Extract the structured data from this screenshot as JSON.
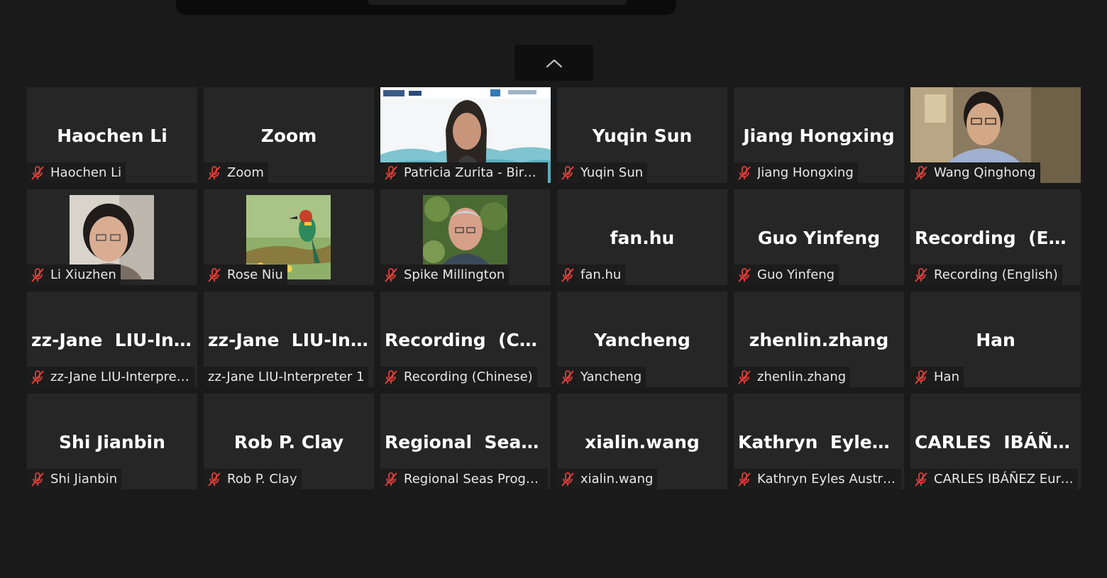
{
  "tiles": [
    {
      "display_name": "Haochen Li",
      "label": "Haochen Li",
      "muted": true
    },
    {
      "display_name": "Zoom",
      "label": "Zoom",
      "muted": true
    },
    {
      "display_name": "",
      "label": "Patricia Zurita - BirdLif...",
      "muted": true
    },
    {
      "display_name": "Yuqin Sun",
      "label": "Yuqin Sun",
      "muted": true
    },
    {
      "display_name": "Jiang Hongxing",
      "label": "Jiang Hongxing",
      "muted": true
    },
    {
      "display_name": "",
      "label": "Wang Qinghong",
      "muted": true
    },
    {
      "display_name": "",
      "label": "Li Xiuzhen",
      "muted": true
    },
    {
      "display_name": "",
      "label": "Rose Niu",
      "muted": true
    },
    {
      "display_name": "",
      "label": "Spike Millington",
      "muted": true
    },
    {
      "display_name": "fan.hu",
      "label": "fan.hu",
      "muted": true
    },
    {
      "display_name": "Guo Yinfeng",
      "label": "Guo Yinfeng",
      "muted": true
    },
    {
      "display_name": "Recording  (Engl...",
      "label": "Recording (English)",
      "muted": true
    },
    {
      "display_name": "zz-Jane  LIU-Int...",
      "label": "zz-Jane LIU-Interprete...",
      "muted": true
    },
    {
      "display_name": "zz-Jane  LIU-Int...",
      "label": "zz-Jane LIU-Interpreter 1",
      "muted": false
    },
    {
      "display_name": "Recording  (Chi...",
      "label": "Recording (Chinese)",
      "muted": true
    },
    {
      "display_name": "Yancheng",
      "label": "Yancheng",
      "muted": true
    },
    {
      "display_name": "zhenlin.zhang",
      "label": "zhenlin.zhang",
      "muted": true
    },
    {
      "display_name": "Han",
      "label": "Han",
      "muted": true
    },
    {
      "display_name": "Shi Jianbin",
      "label": "Shi Jianbin",
      "muted": true
    },
    {
      "display_name": "Rob P. Clay",
      "label": "Rob P. Clay",
      "muted": true
    },
    {
      "display_name": "Regional  Seas  P...",
      "label": "Regional Seas Progra...",
      "muted": true
    },
    {
      "display_name": "xialin.wang",
      "label": "xialin.wang",
      "muted": true
    },
    {
      "display_name": "Kathryn  Eyles  A...",
      "label": "Kathryn Eyles Australia",
      "muted": true
    },
    {
      "display_name": "CARLES  IBÁÑEZ...",
      "label": "CARLES IBÁÑEZ Eurecat",
      "muted": true
    }
  ],
  "icons": {
    "mute": "microphone-muted-icon",
    "collapse": "chevron-up-icon"
  },
  "colors": {
    "background": "#1a1a1a",
    "tile": "#262626",
    "mute_icon": "#e0403a"
  }
}
